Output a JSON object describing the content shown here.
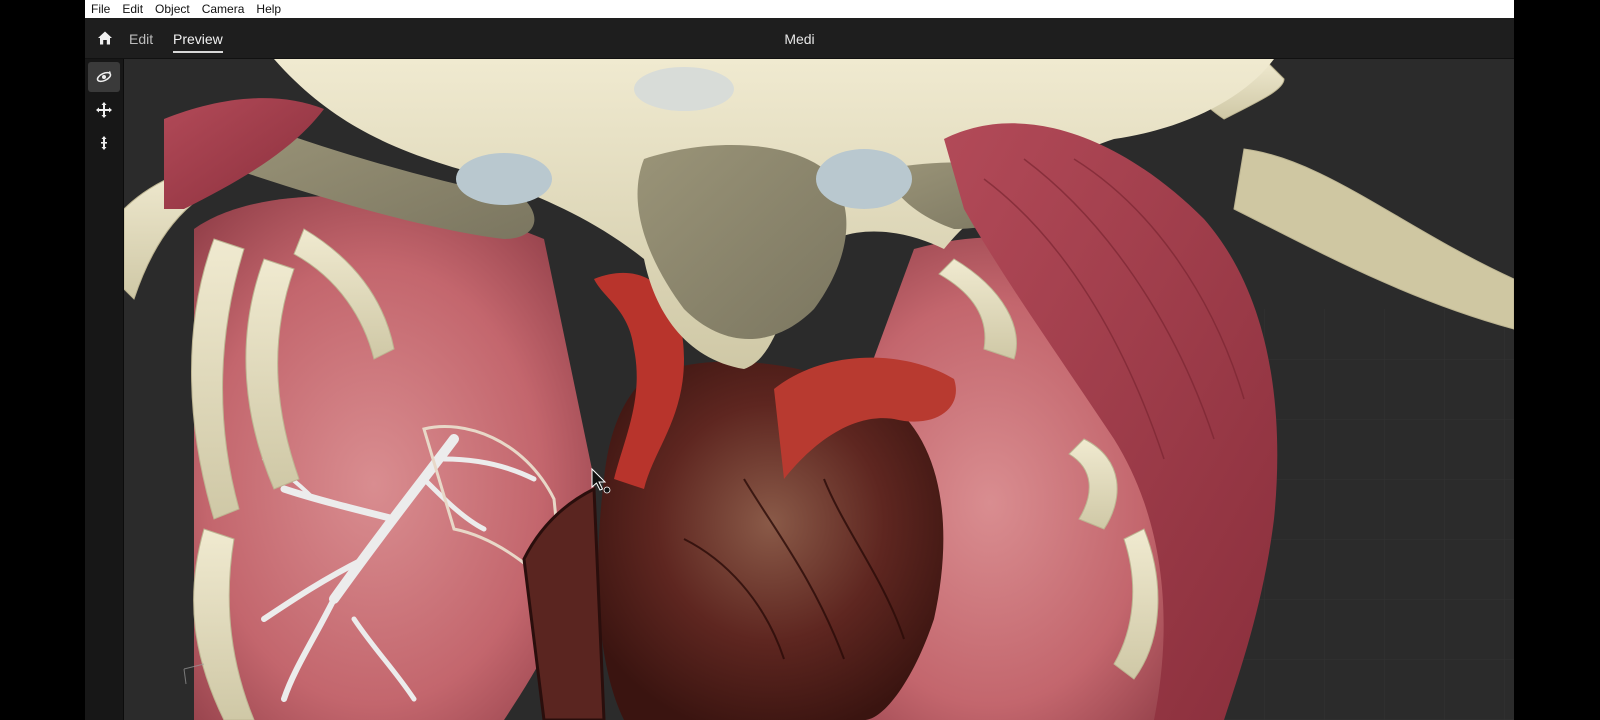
{
  "menubar": {
    "items": [
      "File",
      "Edit",
      "Object",
      "Camera",
      "Help"
    ]
  },
  "toolbar": {
    "tabs": [
      {
        "label": "Edit",
        "active": false
      },
      {
        "label": "Preview",
        "active": true
      }
    ],
    "title": "Medi"
  },
  "tools": [
    {
      "icon": "orbit-icon",
      "active": true
    },
    {
      "icon": "pan-move-icon",
      "active": false
    },
    {
      "icon": "zoom-dolly-icon",
      "active": false
    }
  ],
  "viewport": {
    "scene": "3d-anatomy-thorax-heart",
    "cursor": "arrow-pointer"
  },
  "colors": {
    "menubar_bg": "#ffffff",
    "toolbar_bg": "#1e1e1e",
    "viewport_bg": "#2a2a2a",
    "bone": "#e6e0c2",
    "muscle": "#a03a48",
    "lung": "#c7666e",
    "heart": "#6e2a24"
  }
}
